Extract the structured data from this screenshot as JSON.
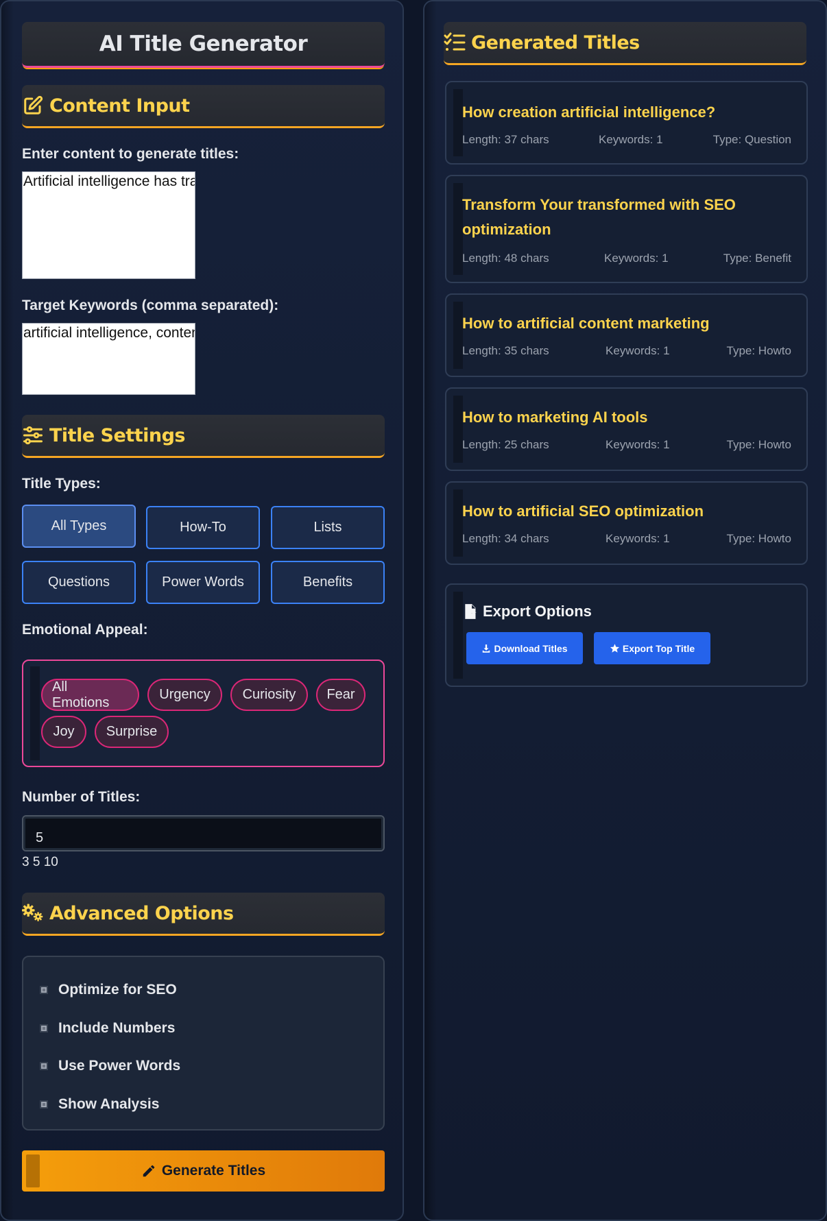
{
  "app": {
    "title": "AI Title Generator"
  },
  "content_input": {
    "header": "Content Input",
    "content_label": "Enter content to generate titles:",
    "content_value": "Artificial intelligence has transformed content creation",
    "keywords_label": "Target Keywords (comma separated):",
    "keywords_value": "artificial intelligence, content marketing, SEO optimization, AI tools"
  },
  "title_settings": {
    "header": "Title Settings",
    "types_label": "Title Types:",
    "types": [
      "All Types",
      "How-To",
      "Lists",
      "Questions",
      "Power Words",
      "Benefits"
    ],
    "active_type": "All Types",
    "emotion_label": "Emotional Appeal:",
    "emotions": [
      "All Emotions",
      "Urgency",
      "Curiosity",
      "Fear",
      "Joy",
      "Surprise"
    ],
    "active_emotion": "All Emotions",
    "count_label": "Number of Titles:",
    "count_value": "5",
    "count_options": "3 5 10"
  },
  "advanced": {
    "header": "Advanced Options",
    "options": [
      "Optimize for SEO",
      "Include Numbers",
      "Use Power Words",
      "Show Analysis"
    ]
  },
  "generate_button": "Generate Titles",
  "results": {
    "header": "Generated Titles",
    "titles": [
      {
        "title": "How creation artificial intelligence?",
        "length": "Length: 37 chars",
        "keywords": "Keywords: 1",
        "type": "Type: Question"
      },
      {
        "title": "Transform Your transformed with SEO optimization",
        "length": "Length: 48 chars",
        "keywords": "Keywords: 1",
        "type": "Type: Benefit"
      },
      {
        "title": "How to artificial content marketing",
        "length": "Length: 35 chars",
        "keywords": "Keywords: 1",
        "type": "Type: Howto"
      },
      {
        "title": "How to marketing AI tools",
        "length": "Length: 25 chars",
        "keywords": "Keywords: 1",
        "type": "Type: Howto"
      },
      {
        "title": "How to artificial SEO optimization",
        "length": "Length: 34 chars",
        "keywords": "Keywords: 1",
        "type": "Type: Howto"
      }
    ]
  },
  "export": {
    "header": "Export Options",
    "download_label": "Download Titles",
    "export_top_label": "Export Top Title"
  },
  "colors": {
    "accent_gold": "#fcd34d",
    "accent_orange": "#f59e0b",
    "accent_pink": "#ec4899",
    "accent_blue": "#3b82f6",
    "background": "#111a2e"
  }
}
